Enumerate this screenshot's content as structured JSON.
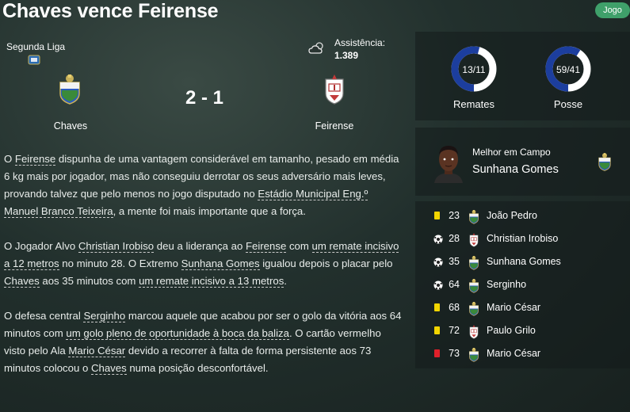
{
  "header": {
    "title": "Chaves vence Feirense",
    "badge": "Jogo"
  },
  "match": {
    "competition": "Segunda Liga",
    "attendance_label": "Assistência:",
    "attendance": "1.389",
    "home_team": "Chaves",
    "away_team": "Feirense",
    "score": "2 - 1"
  },
  "stats": [
    {
      "label": "Remates",
      "value": "13/11",
      "home_share": 0.54
    },
    {
      "label": "Posse",
      "value": "59/41",
      "home_share": 0.59
    }
  ],
  "colors": {
    "home": "#1c3e9e",
    "away": "#ffffff",
    "badge": "#3fa06a",
    "yellow_card": "#f2d500",
    "red_card": "#e0202a"
  },
  "man_of_the_match": {
    "label": "Melhor em Campo",
    "name": "Sunhana Gomes"
  },
  "events": [
    {
      "type": "yellow-card",
      "minute": "23",
      "team": "home",
      "player": "João Pedro"
    },
    {
      "type": "goal",
      "minute": "28",
      "team": "away",
      "player": "Christian Irobiso"
    },
    {
      "type": "goal",
      "minute": "35",
      "team": "home",
      "player": "Sunhana Gomes"
    },
    {
      "type": "goal",
      "minute": "64",
      "team": "home",
      "player": "Serginho"
    },
    {
      "type": "yellow-card",
      "minute": "68",
      "team": "home",
      "player": "Mario César"
    },
    {
      "type": "yellow-card",
      "minute": "72",
      "team": "away",
      "player": "Paulo Grilo"
    },
    {
      "type": "red-card",
      "minute": "73",
      "team": "home",
      "player": "Mario César"
    }
  ],
  "report": {
    "p1": {
      "t1": "O ",
      "l1": "Feirense",
      "t2": " dispunha de uma vantagem considerável em tamanho, pesado em média 6 kg mais por jogador, mas não conseguiu derrotar os seus adversário mais leves, provando talvez que pelo menos no jogo disputado no ",
      "l2": "Estádio Municipal Eng.º Manuel Branco Teixeira",
      "t3": ", a mente foi mais importante que a força."
    },
    "p2": {
      "t1": "O Jogador Alvo ",
      "l1": "Christian Irobiso",
      "t2": " deu a liderança ao ",
      "l2": "Feirense",
      "t3": " com ",
      "l3": "um remate incisivo a 12 metros",
      "t4": " no minuto 28. O Extremo ",
      "l4": "Sunhana Gomes",
      "t5": " igualou depois o placar pelo ",
      "l5": "Chaves",
      "t6": " aos 35 minutos com ",
      "l6": "um remate incisivo a 13 metros",
      "t7": "."
    },
    "p3": {
      "t1": "O defesa central ",
      "l1": "Serginho",
      "t2": " marcou aquele que acabou por ser o golo da vitória aos 64 minutos com ",
      "l2": "um golo pleno de oportunidade à boca da baliza",
      "t3": ". O cartão vermelho visto pelo Ala ",
      "l3": "Mario César",
      "t4": " devido a recorrer à falta de forma persistente aos 73 minutos colocou o ",
      "l4": "Chaves",
      "t5": " numa posição desconfortável."
    }
  }
}
